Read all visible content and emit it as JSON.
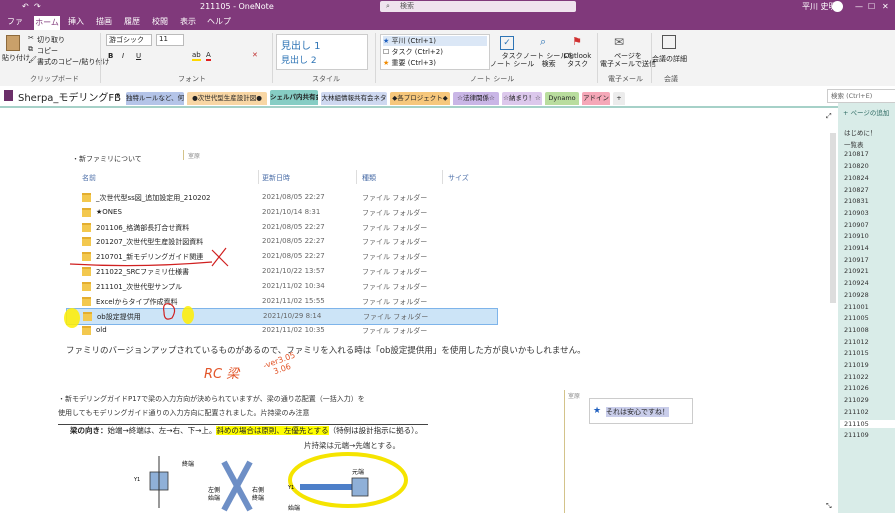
{
  "title_bar": {
    "title": "211105 - OneNote",
    "search_placeholder": "検索",
    "user": "平川 史明",
    "win_min": "—",
    "win_max": "☐",
    "win_close": "✕"
  },
  "ribbon_tabs": [
    "ファイル",
    "ホーム",
    "挿入",
    "描画",
    "履歴",
    "校閲",
    "表示",
    "ヘルプ"
  ],
  "ribbon": {
    "clipboard": {
      "paste": "貼り付け",
      "cut": "切り取り",
      "copy": "コピー",
      "format_paint": "書式のコピー/貼り付け",
      "label": "クリップボード"
    },
    "font": {
      "family": "游ゴシック",
      "size": "11",
      "bold": "B",
      "italic": "I",
      "underline": "U",
      "label": "フォント"
    },
    "styles": {
      "h1": "見出し 1",
      "h2": "見出し 2",
      "label": "スタイル"
    },
    "tags": {
      "t1": "平川 (Ctrl+1)",
      "t2": "タスク (Ctrl+2)",
      "t3": "重要 (Ctrl+3)",
      "task": "タスク\nノート シール",
      "find": "ノート シールを\n検索",
      "outlook": "Outlook\nタスク",
      "label": "ノート シール"
    },
    "email": {
      "send": "ページを\n電子メールで送信",
      "label": "電子メール"
    },
    "meetings": {
      "details": "会議の詳細",
      "label": "会議"
    }
  },
  "notebook": {
    "name": "Sherpa_モデリングFB",
    "search_placeholder": "検索 (Ctrl+E)"
  },
  "section_tabs": [
    {
      "label": "独特ルールなど、何でも！",
      "color": "#b4c4e8"
    },
    {
      "label": "●次世代型生産設計図●",
      "color": "#f8d6a4"
    },
    {
      "label": "シェルパ内共有会",
      "color": "#86cdc4"
    },
    {
      "label": "大林組情報共有会ネタ",
      "color": "#ced8f0"
    },
    {
      "label": "◆各プロジェクト◆",
      "color": "#f6c77c"
    },
    {
      "label": "☆法律関係☆",
      "color": "#c9b6e6"
    },
    {
      "label": "☆納まり！☆",
      "color": "#dcc8ec"
    },
    {
      "label": "Dynamo",
      "color": "#b9dd9e"
    },
    {
      "label": "アドイン",
      "color": "#f5a8b8"
    },
    {
      "label": "+",
      "color": "#ececec"
    }
  ],
  "page_pane": {
    "add_page": "+ ページの追加",
    "pages": [
      "はじめに！",
      "一覧表",
      "210817",
      "210820",
      "210824",
      "210827",
      "210831",
      "210903",
      "210907",
      "210910",
      "210914",
      "210917",
      "210921",
      "210924",
      "210928",
      "211001",
      "211005",
      "211008",
      "211012",
      "211015",
      "211019",
      "211022",
      "211026",
      "211029",
      "211102",
      "211105",
      "211109"
    ],
    "selected": "211105"
  },
  "content": {
    "heading": "・新ファミリについて",
    "tag_note": "室原",
    "columns": [
      "名前",
      "更新日時",
      "種類",
      "サイズ"
    ],
    "rows": [
      {
        "name": "_次世代型ss図_追加設定用_210202",
        "date": "2021/08/05 22:27",
        "type": "ファイル フォルダー",
        "selected": false
      },
      {
        "name": "★ONES",
        "date": "2021/10/14 8:31",
        "type": "ファイル フォルダー",
        "selected": false
      },
      {
        "name": "201106_格満部長打合せ資料",
        "date": "2021/08/05 22:27",
        "type": "ファイル フォルダー",
        "selected": false
      },
      {
        "name": "201207_次世代型生産設計図資料",
        "date": "2021/08/05 22:27",
        "type": "ファイル フォルダー",
        "selected": false
      },
      {
        "name": "210701_新モデリングガイド関連",
        "date": "2021/08/05 22:27",
        "type": "ファイル フォルダー",
        "selected": false
      },
      {
        "name": "211022_SRCファミリ仕様書",
        "date": "2021/10/22 13:57",
        "type": "ファイル フォルダー",
        "selected": false
      },
      {
        "name": "211101_次世代型サンプル",
        "date": "2021/11/02 10:34",
        "type": "ファイル フォルダー",
        "selected": false
      },
      {
        "name": "Excelからタイプ作成資料",
        "date": "2021/11/02 15:55",
        "type": "ファイル フォルダー",
        "selected": false
      },
      {
        "name": "ob設定提供用",
        "date": "2021/10/29 8:14",
        "type": "ファイル フォルダー",
        "selected": true
      },
      {
        "name": "old",
        "date": "2021/11/02 10:35",
        "type": "ファイル フォルダー",
        "selected": false
      }
    ],
    "para1": "ファミリのバージョンアップされているものがあるので、ファミリを入れる時は「ob設定提供用」を使用した方が良いかもしれません。",
    "hand_rc": "RC 梁",
    "hand_ver": "-ver3.05\n   3.06",
    "para2a": "・新モデリングガイドP17で梁の入力方向が決められていますが、梁の通り芯配置（一括入力）を",
    "para2b": "使用してもモデリングガイド通りの入力方向に配置されました。片持梁のみ注意",
    "side_tag_note": "室原",
    "side_comment": "それは安心ですね！",
    "beam_rule_prefix": "梁の向き：",
    "beam_rule_mid": "始端→終端は、左→右、下→上。",
    "beam_rule_hl": "斜めの場合は原則、左優先とする",
    "beam_rule_suffix": "（特例は設計指示に拠る）。",
    "beam_rule2": "片持梁は元端→先端とする。",
    "diagram": {
      "end": "終端",
      "left_start": "左側\n始端",
      "right_end": "右側\n終端",
      "y1": "Y1",
      "motobata": "元端",
      "start": "始端",
      "sakitan": "先端"
    }
  }
}
